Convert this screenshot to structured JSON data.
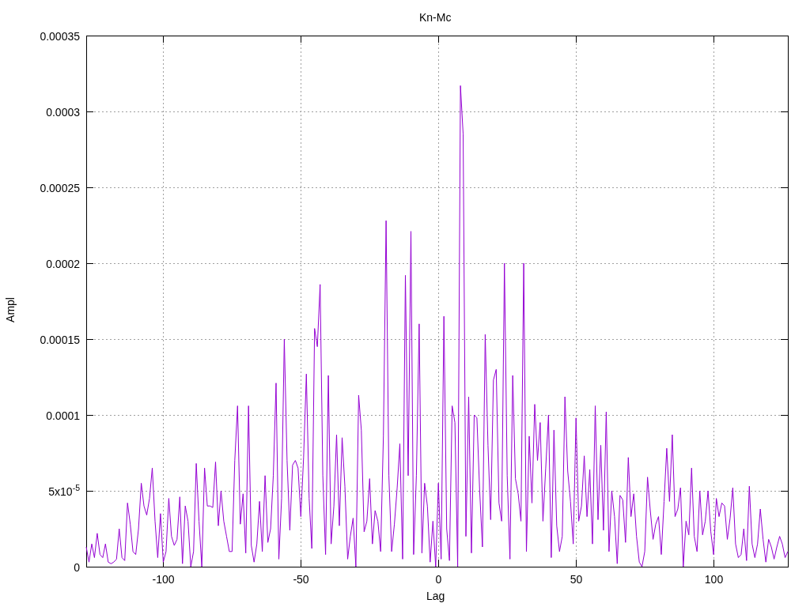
{
  "chart_data": {
    "type": "line",
    "title": "Kn-Mc",
    "xlabel": "Lag",
    "ylabel": "Ampl",
    "xlim": [
      -128,
      127
    ],
    "ylim": [
      0,
      0.00035
    ],
    "xticks": [
      -100,
      -50,
      0,
      50,
      100
    ],
    "grid": true,
    "x": [
      -128,
      -127,
      -126,
      -125,
      -124,
      -123,
      -122,
      -121,
      -120,
      -119,
      -118,
      -117,
      -116,
      -115,
      -114,
      -113,
      -112,
      -111,
      -110,
      -109,
      -108,
      -107,
      -106,
      -105,
      -104,
      -103,
      -102,
      -101,
      -100,
      -99,
      -98,
      -97,
      -96,
      -95,
      -94,
      -93,
      -92,
      -91,
      -90,
      -89,
      -88,
      -87,
      -86,
      -85,
      -84,
      -83,
      -82,
      -81,
      -80,
      -79,
      -78,
      -77,
      -76,
      -75,
      -74,
      -73,
      -72,
      -71,
      -70,
      -69,
      -68,
      -67,
      -66,
      -65,
      -64,
      -63,
      -62,
      -61,
      -60,
      -59,
      -58,
      -57,
      -56,
      -55,
      -54,
      -53,
      -52,
      -51,
      -50,
      -49,
      -48,
      -47,
      -46,
      -45,
      -44,
      -43,
      -42,
      -41,
      -40,
      -39,
      -38,
      -37,
      -36,
      -35,
      -34,
      -33,
      -32,
      -31,
      -30,
      -29,
      -28,
      -27,
      -26,
      -25,
      -24,
      -23,
      -22,
      -21,
      -20,
      -19,
      -18,
      -17,
      -16,
      -15,
      -14,
      -13,
      -12,
      -11,
      -10,
      -9,
      -8,
      -7,
      -6,
      -5,
      -4,
      -3,
      -2,
      -1,
      0,
      1,
      2,
      3,
      4,
      5,
      6,
      7,
      8,
      9,
      10,
      11,
      12,
      13,
      14,
      15,
      16,
      17,
      18,
      19,
      20,
      21,
      22,
      23,
      24,
      25,
      26,
      27,
      28,
      29,
      30,
      31,
      32,
      33,
      34,
      35,
      36,
      37,
      38,
      39,
      40,
      41,
      42,
      43,
      44,
      45,
      46,
      47,
      48,
      49,
      50,
      51,
      52,
      53,
      54,
      55,
      56,
      57,
      58,
      59,
      60,
      61,
      62,
      63,
      64,
      65,
      66,
      67,
      68,
      69,
      70,
      71,
      72,
      73,
      74,
      75,
      76,
      77,
      78,
      79,
      80,
      81,
      82,
      83,
      84,
      85,
      86,
      87,
      88,
      89,
      90,
      91,
      92,
      93,
      94,
      95,
      96,
      97,
      98,
      99,
      100,
      101,
      102,
      103,
      104,
      105,
      106,
      107,
      108,
      109,
      110,
      111,
      112,
      113,
      114,
      115,
      116,
      117,
      118,
      119,
      120,
      121,
      122,
      123,
      124,
      125,
      126,
      127
    ],
    "yticks": [
      0,
      {
        "value": 5e-05,
        "label": "5x10$^{-5}$"
      },
      0.0001,
      0.00015,
      0.0002,
      0.00025,
      0.0003,
      0.00035
    ],
    "series": [
      {
        "color": "#9400d3",
        "values": [
          1.3e-05,
          3e-06,
          1.5e-05,
          6e-06,
          2.2e-05,
          8e-06,
          6e-06,
          1.5e-05,
          3e-06,
          2e-06,
          3e-06,
          5e-06,
          2.5e-05,
          6e-06,
          4e-06,
          4.2e-05,
          2.8e-05,
          1e-05,
          8e-06,
          2.5e-05,
          5.5e-05,
          4e-05,
          3.4e-05,
          4.5e-05,
          6.5e-05,
          3e-05,
          6e-06,
          3.5e-05,
          3e-06,
          1e-05,
          4.5e-05,
          2e-05,
          1.4e-05,
          1.8e-05,
          4.6e-05,
          2e-06,
          4e-05,
          3e-05,
          0,
          1e-05,
          6.8e-05,
          3e-05,
          0,
          6.5e-05,
          4e-05,
          4e-05,
          3.9e-05,
          6.9e-05,
          2.7e-05,
          5e-05,
          3e-05,
          2e-05,
          1e-05,
          1e-05,
          7e-05,
          0.000106,
          2.8e-05,
          4.8e-05,
          9e-06,
          0.000106,
          1.4e-05,
          3e-06,
          1.5e-05,
          4.3e-05,
          1e-05,
          6e-05,
          1.6e-05,
          2.5e-05,
          6e-05,
          0.000121,
          5e-06,
          4.5e-05,
          0.00015,
          7e-05,
          2.4e-05,
          6.7e-05,
          7e-05,
          6.5e-05,
          3.3e-05,
          7.2e-05,
          0.000127,
          4.5e-05,
          1.2e-05,
          0.000157,
          0.000145,
          0.000186,
          6e-05,
          8e-06,
          0.000126,
          1.5e-05,
          4e-05,
          8.7e-05,
          2.7e-05,
          8.5e-05,
          5.3e-05,
          5e-06,
          2e-05,
          3.2e-05,
          0,
          0.000113,
          9e-05,
          2.3e-05,
          3e-05,
          5.8e-05,
          1.5e-05,
          3.7e-05,
          3e-05,
          1e-05,
          8.6e-05,
          0.000228,
          6e-05,
          1e-05,
          2.8e-05,
          5.2e-05,
          8.1e-05,
          5e-06,
          0.000192,
          6e-05,
          0.000221,
          8e-06,
          6e-05,
          0.00016,
          9e-06,
          5.5e-05,
          4e-05,
          3e-06,
          3e-05,
          0,
          5.5e-05,
          5e-06,
          0.000165,
          2.5e-05,
          4e-06,
          0.000106,
          9.5e-05,
          0,
          0.000317,
          0.000285,
          2e-05,
          0.000112,
          9e-06,
          0.0001,
          9.8e-05,
          5e-05,
          1.3e-05,
          0.000153,
          8e-05,
          3.1e-05,
          0.000123,
          0.00013,
          4.2e-05,
          3e-05,
          0.0002,
          6e-05,
          5e-06,
          0.000126,
          5.8e-05,
          4.8e-05,
          3e-05,
          0.0002,
          1e-05,
          8.6e-05,
          4.2e-05,
          0.000107,
          7e-05,
          9.5e-05,
          3e-05,
          6.5e-05,
          0.0001,
          6e-06,
          9e-05,
          2.7e-05,
          1e-05,
          2e-05,
          0.000112,
          6.3e-05,
          4.3e-05,
          1.5e-05,
          9.8e-05,
          3e-05,
          4e-05,
          7.3e-05,
          3.3e-05,
          6.4e-05,
          1.5e-05,
          0.000106,
          3.1e-05,
          8e-05,
          2.4e-05,
          0.000102,
          1e-05,
          5e-05,
          3.3e-05,
          2e-06,
          4.7e-05,
          4.4e-05,
          1.6e-05,
          7.2e-05,
          3.3e-05,
          4.8e-05,
          2e-05,
          3e-06,
          0,
          1e-05,
          5.9e-05,
          3.7e-05,
          1.8e-05,
          2.8e-05,
          3.3e-05,
          8e-06,
          4.3e-05,
          7.8e-05,
          4.3e-05,
          8.7e-05,
          3.3e-05,
          3.8e-05,
          5.2e-05,
          0,
          3e-05,
          2.1e-05,
          6.5e-05,
          2e-05,
          1e-05,
          5e-05,
          2.1e-05,
          3e-05,
          5e-05,
          2.3e-05,
          8e-06,
          4.5e-05,
          3.3e-05,
          4.2e-05,
          4e-05,
          1.8e-05,
          3.2e-05,
          5.2e-05,
          1.5e-05,
          6e-06,
          8e-06,
          2.5e-05,
          4e-06,
          5.3e-05,
          1.5e-05,
          6e-06,
          1.5e-05,
          3.8e-05,
          1.8e-05,
          3e-06,
          1.8e-05,
          1.3e-05,
          5e-06,
          1.3e-05,
          2e-05,
          1.5e-05,
          6e-06,
          1e-05
        ]
      }
    ]
  }
}
